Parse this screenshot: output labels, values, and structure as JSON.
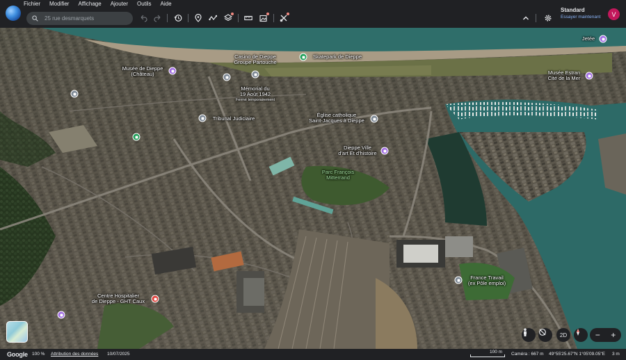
{
  "menu": [
    "Fichier",
    "Modifier",
    "Affichage",
    "Ajouter",
    "Outils",
    "Aide"
  ],
  "search": {
    "placeholder": "25 rue desmarquets"
  },
  "profile": {
    "name": "Standard",
    "link": "Essayer maintenant",
    "avatar_letter": "V"
  },
  "icons": {
    "toolbar": [
      "undo-icon",
      "redo-icon",
      "history-icon",
      "place-pin-icon",
      "path-icon",
      "layers-icon",
      "ruler-icon",
      "image-add-icon",
      "drawing-tools-icon",
      "chevron-up-icon",
      "gear-icon"
    ],
    "controls": [
      "pegman-icon",
      "compass-reset-icon",
      "2d-toggle",
      "compass-icon",
      "zoom-out-icon",
      "zoom-in-icon"
    ]
  },
  "colors": {
    "chrome": "#202124",
    "sea": "#2f6e6a",
    "accent_link": "#8ab4f8",
    "avatar": "#c2185b"
  },
  "places": [
    {
      "name": "Jetée",
      "type": "purple"
    },
    {
      "name": "Casino de Dieppe",
      "sub2": "Groupe Partouche",
      "type": "grey"
    },
    {
      "name": "Skatepark de Dieppe",
      "type": "green"
    },
    {
      "name": "Musée de Dieppe",
      "sub2": "(Château)",
      "type": "purple"
    },
    {
      "name": "Musée Estran",
      "sub2": "Cité de la Mer",
      "type": "purple"
    },
    {
      "name": "Mémorial du",
      "sub2": "19 Août 1942",
      "note": "Fermé temporairement",
      "type": "grey"
    },
    {
      "name": "Tribunal Judiciaire",
      "type": "grey"
    },
    {
      "name": "Église catholique",
      "sub2": "Saint-Jacques à Dieppe",
      "type": "grey"
    },
    {
      "name": "Dieppe Ville",
      "sub2": "d'art Et d'histoire",
      "type": "purple"
    },
    {
      "name": "Parc François",
      "sub2": "Mitterrand",
      "type": "green-label"
    },
    {
      "name": "Centre Hospitalier",
      "sub2": "de Dieppe - GHT Caux",
      "type": "red"
    },
    {
      "name": "France Travail",
      "sub2": "(ex Pôle emploi)",
      "type": "grey"
    }
  ],
  "controls": {
    "twod": "2D",
    "zoom_out": "−",
    "zoom_in": "+"
  },
  "status": {
    "brand": "Google",
    "zoom": "100 %",
    "attribution": "Attribution des données",
    "date": "10/07/2025",
    "scale": "100 m",
    "camera": "Caméra : 667 m",
    "coords": "49°55'25.67\"N 1°05'09.05\"E",
    "altitude": "3 m"
  }
}
